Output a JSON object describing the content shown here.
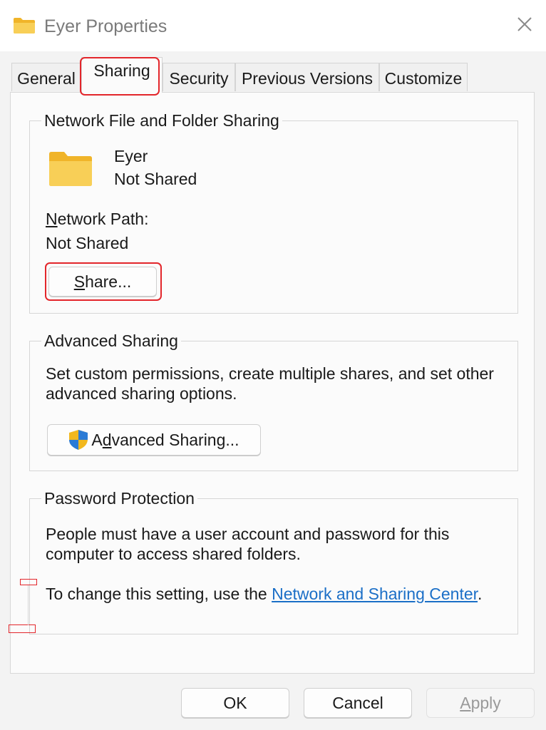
{
  "window": {
    "title": "Eyer Properties",
    "close_icon": "close-icon",
    "folder_icon": "folder-icon"
  },
  "tabs": [
    {
      "label": "General"
    },
    {
      "label": "Sharing",
      "active": true
    },
    {
      "label": "Security"
    },
    {
      "label": "Previous Versions"
    },
    {
      "label": "Customize"
    }
  ],
  "network_sharing": {
    "group_label": "Network File and Folder Sharing",
    "folder_name": "Eyer",
    "folder_status": "Not Shared",
    "path_label_accel": "N",
    "path_label_rest": "etwork Path:",
    "path_value": "Not Shared",
    "share_button_accel": "S",
    "share_button_rest": "hare..."
  },
  "advanced_sharing": {
    "group_label": "Advanced Sharing",
    "description_line1": "Set custom permissions, create multiple shares, and set other",
    "description_line2": "advanced sharing options.",
    "button_pre": "A",
    "button_accel": "d",
    "button_rest": "vanced Sharing...",
    "button_icon": "uac-shield-icon"
  },
  "password_protection": {
    "group_label": "Password Protection",
    "line1": "People must have a user account and password for this",
    "line2": "computer to access shared folders.",
    "change_prefix": "To change this setting, use the ",
    "link_text": "Network and Sharing Center",
    "change_suffix": "."
  },
  "footer": {
    "ok_label": "OK",
    "cancel_label": "Cancel",
    "apply_accel": "A",
    "apply_rest": "pply"
  },
  "colors": {
    "highlight": "#e3262b",
    "link": "#1b6fc7",
    "folder": "#f6c342"
  }
}
